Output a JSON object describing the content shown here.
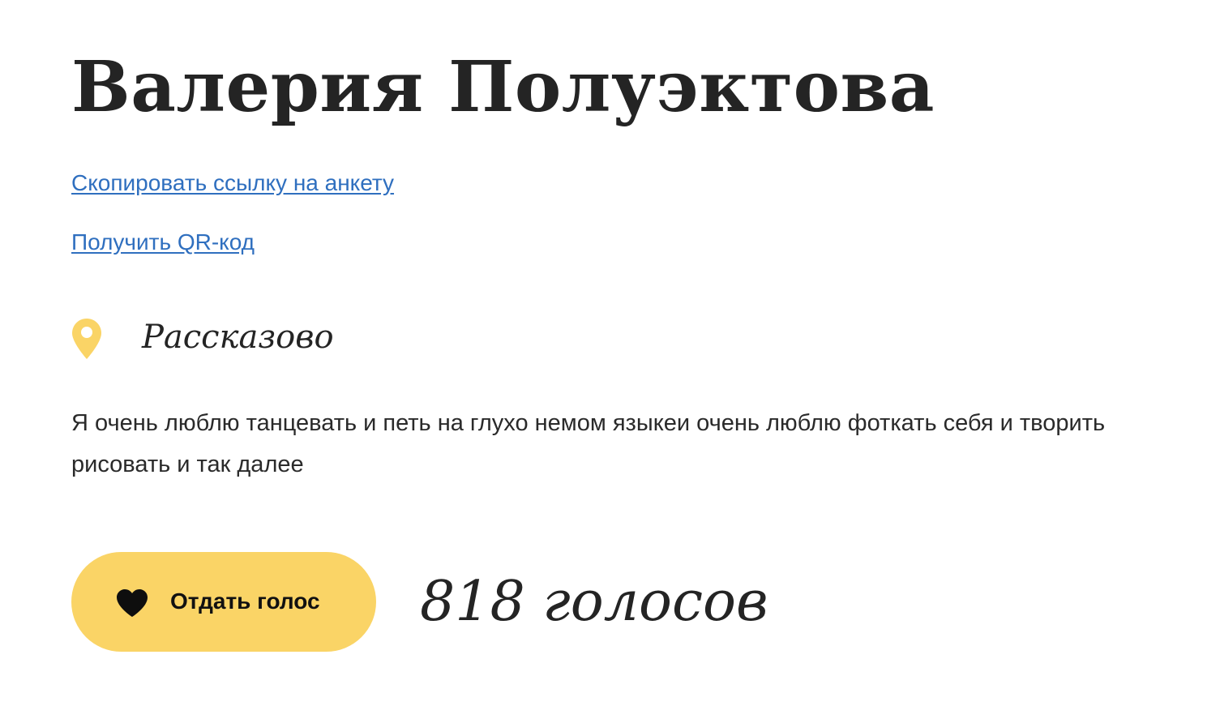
{
  "profile": {
    "name": "Валерия  Полуэктова",
    "copy_link_label": "Скопировать ссылку на анкету",
    "qr_link_label": "Получить QR-код",
    "location": {
      "icon": "map-pin-icon",
      "city": "Рассказово"
    },
    "bio": "Я очень люблю танцевать и петь на глухо немом языкеи очень люблю фоткать себя и творить рисовать и так далее",
    "vote": {
      "icon": "heart-icon",
      "button_label": "Отдать голос",
      "count_text": "818 голосов"
    }
  },
  "colors": {
    "accent": "#fad466",
    "link": "#2f6fbf",
    "text": "#242424"
  }
}
